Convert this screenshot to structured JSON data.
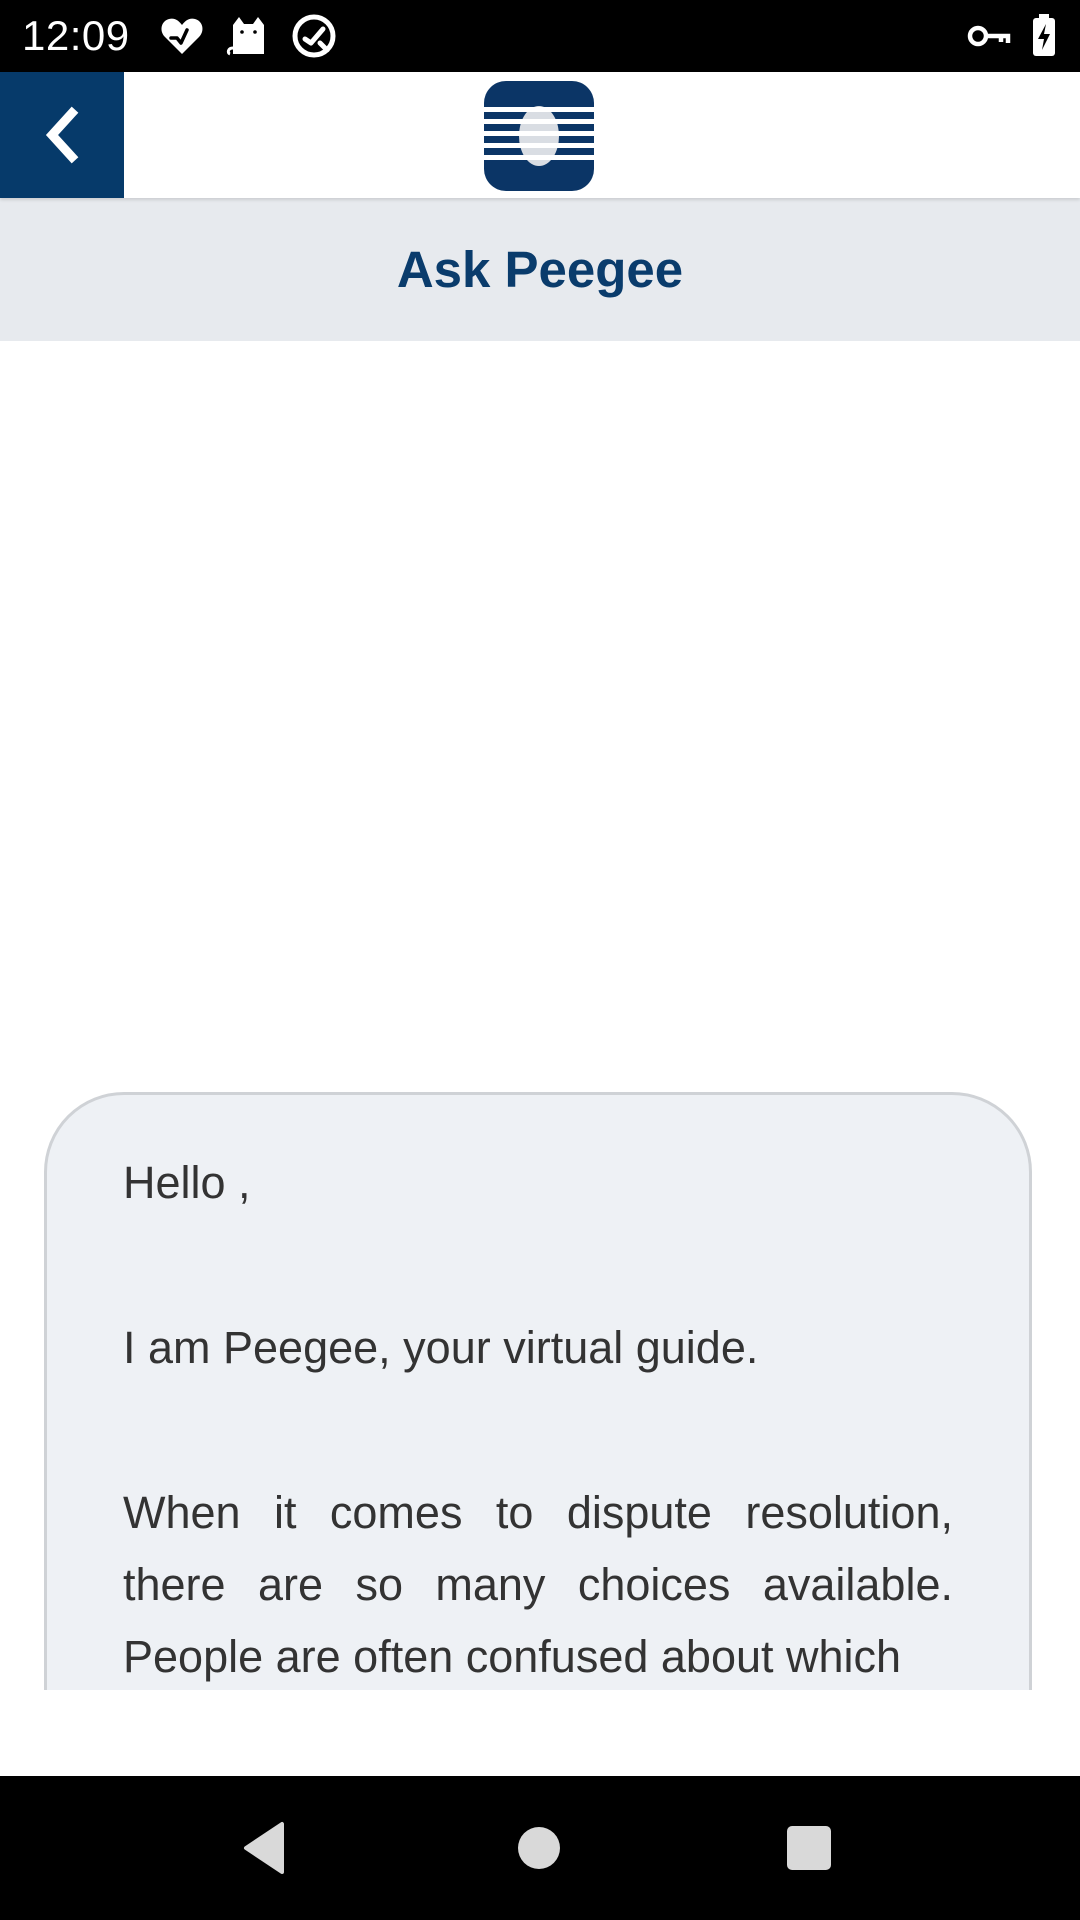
{
  "status_bar": {
    "time": "12:09",
    "left_icons": [
      "health-heart-icon",
      "cat-icon",
      "sync-at-icon"
    ],
    "right_icons": [
      "vpn-key-icon",
      "battery-charging-icon"
    ]
  },
  "header": {
    "back_icon": "chevron-left-icon",
    "logo": "striped-globe-logo",
    "brand_color": "#063a6a"
  },
  "title_bar": {
    "title": "Ask Peegee",
    "background": "#e7eaee"
  },
  "chat": {
    "message": {
      "greeting": "Hello ,",
      "intro": "I am Peegee, your virtual guide.",
      "body": "When it comes to dispute resolution, there are so many choices available. People are often confused about which"
    },
    "bubble_color": "#eef1f5"
  },
  "nav_bar": {
    "buttons": [
      "back-triangle-icon",
      "home-circle-icon",
      "recents-square-icon"
    ]
  }
}
